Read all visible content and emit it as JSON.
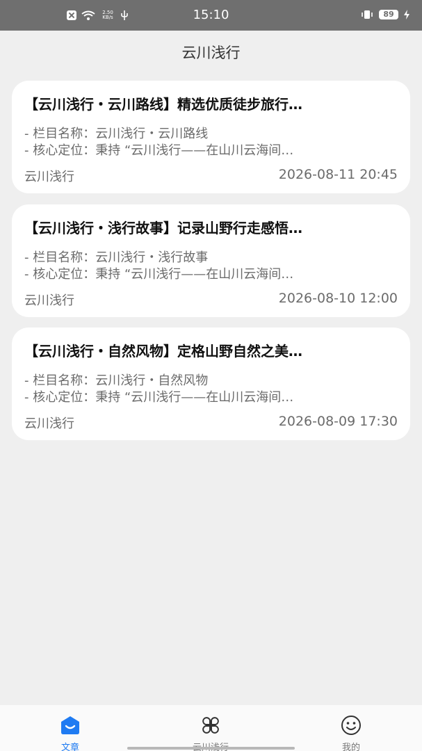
{
  "status_bar": {
    "net_speed_value": "2.50",
    "net_speed_unit": "KB/s",
    "time": "15:10",
    "battery": "89"
  },
  "header": {
    "title": "云川浅行"
  },
  "articles": [
    {
      "title": "【云川浅行・云川路线】精选优质徒步旅行…",
      "column_line": "- 栏目名称：云川浅行・云川路线",
      "position_line": "- 核心定位：秉持 “云川浅行——在山川云海间…",
      "source": "云川浅行",
      "date": "2026-08-11 20:45"
    },
    {
      "title": "【云川浅行・浅行故事】记录山野行走感悟…",
      "column_line": "- 栏目名称：云川浅行・浅行故事",
      "position_line": "- 核心定位：秉持 “云川浅行——在山川云海间…",
      "source": "云川浅行",
      "date": "2026-08-10 12:00"
    },
    {
      "title": "【云川浅行・自然风物】定格山野自然之美…",
      "column_line": "- 栏目名称：云川浅行・自然风物",
      "position_line": "- 核心定位：秉持 “云川浅行——在山川云海间…",
      "source": "云川浅行",
      "date": "2026-08-09 17:30"
    }
  ],
  "tabs": [
    {
      "label": "文章",
      "icon": "article-icon",
      "active": true
    },
    {
      "label": "云川浅行",
      "icon": "grid-icon",
      "active": false
    },
    {
      "label": "我的",
      "icon": "smile-icon",
      "active": false
    }
  ],
  "colors": {
    "accent": "#1f7bf2",
    "background": "#efefef",
    "status_bar": "#6f6f6f"
  }
}
